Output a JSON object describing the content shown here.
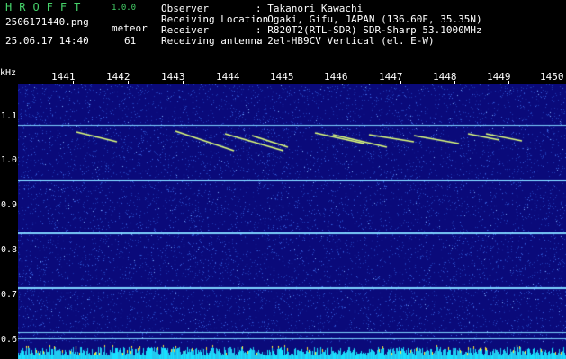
{
  "app": {
    "title": "HROFFT",
    "version": "1.0.0",
    "filename": "2506171440.png",
    "datetime": "25.06.17 14:40",
    "meteor_label": "meteor",
    "meteor_count": "61"
  },
  "info": [
    {
      "label": "Observer",
      "value": ": Takanori Kawachi"
    },
    {
      "label": "Receiving Location",
      "value": ": Ogaki, Gifu, JAPAN (136.60E, 35.35N)"
    },
    {
      "label": "Receiver",
      "value": ": R820T2(RTL-SDR) SDR-Sharp 53.1000MHz"
    },
    {
      "label": "Receiving antenna",
      "value": ": 2el-HB9CV Vertical (el. E-W)"
    }
  ],
  "axis": {
    "unit": "kHz",
    "time_ticks": [
      "1441",
      "1442",
      "1443",
      "1444",
      "1445",
      "1446",
      "1447",
      "1448",
      "1449",
      "1450"
    ],
    "freq_ticks": [
      "1.1",
      "1.0",
      "0.9",
      "0.8",
      "0.7",
      "0.6"
    ]
  },
  "colors": {
    "background": "#0a0a7a",
    "noise": "#2a4fd0",
    "carrier": "#7fd3ff",
    "meteor": "#dfff7a",
    "bottom_trace": "#ffe23a",
    "title_green": "#46d36a"
  }
}
